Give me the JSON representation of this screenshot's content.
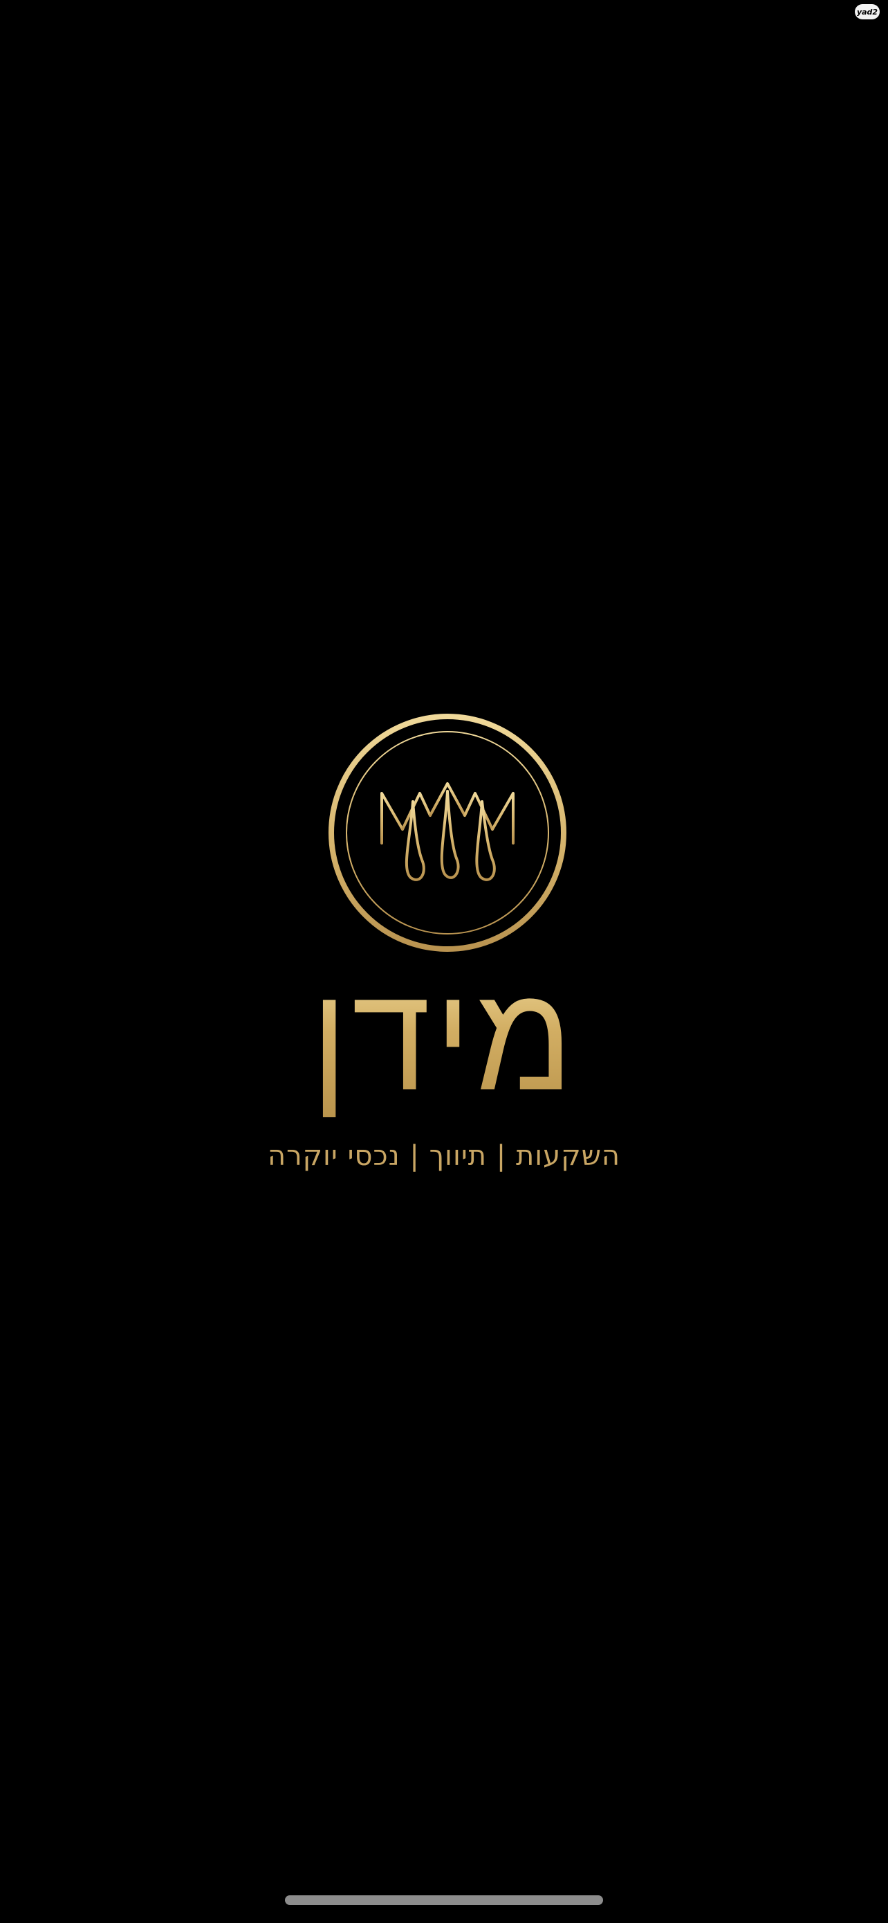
{
  "watermark": {
    "label": "yad2"
  },
  "logo": {
    "icon": "crown-monogram-m-icon",
    "ring_color": "#d9bb78"
  },
  "brand": {
    "name": "מידן",
    "tagline": "השקעות | תיווך | נכסי יוקרה",
    "gold_color": "#d2ae63"
  },
  "system": {
    "home_indicator": "home-indicator"
  }
}
